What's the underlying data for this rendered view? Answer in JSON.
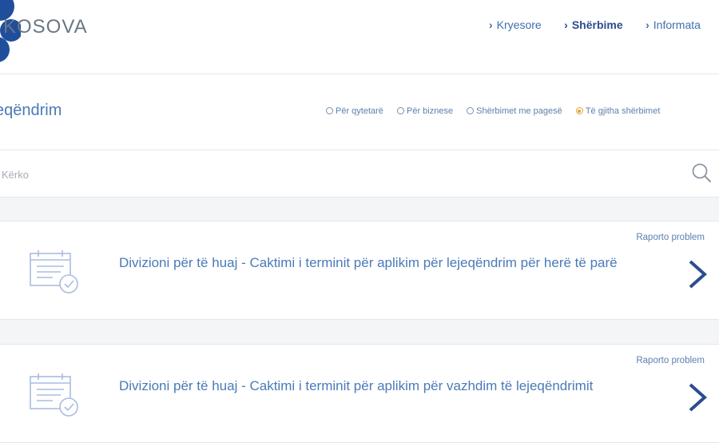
{
  "header": {
    "logo_text": "KOSOVA",
    "nav": [
      {
        "label": "Kryesore",
        "active": false
      },
      {
        "label": "Shërbime",
        "active": true
      },
      {
        "label": "Informata",
        "active": false
      }
    ]
  },
  "page": {
    "title": "eqëndrim"
  },
  "filters": [
    {
      "label": "Për qytetarë",
      "checked": false
    },
    {
      "label": "Për biznese",
      "checked": false
    },
    {
      "label": "Shërbimet me pagesë",
      "checked": false
    },
    {
      "label": "Të gjitha shërbimet",
      "checked": true
    }
  ],
  "search": {
    "placeholder": "Kërko",
    "value": ""
  },
  "services": [
    {
      "title": "Divizioni për të huaj - Caktimi i terminit për aplikim për lejeqëndrim për herë të parë",
      "report": "Raporto problem"
    },
    {
      "title": "Divizioni për të huaj - Caktimi i terminit për aplikim për vazhdim të lejeqëndrimit",
      "report": "Raporto problem"
    }
  ],
  "colors": {
    "brand_blue": "#2c4d8f",
    "link_blue": "#4a7ab8",
    "accent_orange": "#e0a63b"
  }
}
